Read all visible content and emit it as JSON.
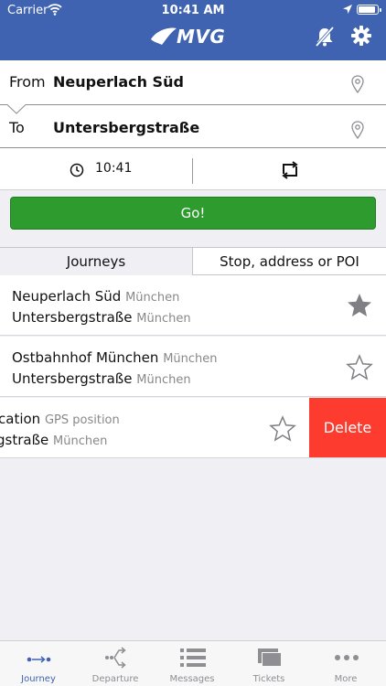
{
  "status_bar": {
    "carrier": "Carrier",
    "time": "10:41 AM"
  },
  "header": {
    "logo_text": "MVG",
    "icons": [
      "bell-muted-icon",
      "gear-icon"
    ]
  },
  "journey_form": {
    "from_label": "From",
    "from_value": "Neuperlach Süd",
    "to_label": "To",
    "to_value": "Untersbergstraße",
    "time_value": "10:41",
    "go_label": "Go!"
  },
  "tabs": [
    {
      "label": "Journeys",
      "selected": true
    },
    {
      "label": "Stop, address or POI",
      "selected": false
    }
  ],
  "journeys": [
    {
      "from_name": "Neuperlach Süd",
      "from_city": "München",
      "to_name": "Untersbergstraße",
      "to_city": "München",
      "favorite": true
    },
    {
      "from_name": "Ostbahnhof München",
      "from_city": "München",
      "to_name": "Untersbergstraße",
      "to_city": "München",
      "favorite": false
    },
    {
      "from_name": "cation",
      "from_city": "GPS position",
      "to_name": "gstraße",
      "to_city": "München",
      "favorite": false,
      "swipe_action": "Delete"
    }
  ],
  "tab_bar": [
    {
      "label": "Journey",
      "icon": "journey-icon",
      "active": true
    },
    {
      "label": "Departure",
      "icon": "departure-icon",
      "active": false
    },
    {
      "label": "Messages",
      "icon": "messages-icon",
      "active": false
    },
    {
      "label": "Tickets",
      "icon": "tickets-icon",
      "active": false
    },
    {
      "label": "More",
      "icon": "more-icon",
      "active": false
    }
  ],
  "colors": {
    "brand_blue": "#3f63b0",
    "go_green": "#2d9b2d",
    "delete_red": "#fd3b2e",
    "star_fill": "#7f7f84"
  }
}
